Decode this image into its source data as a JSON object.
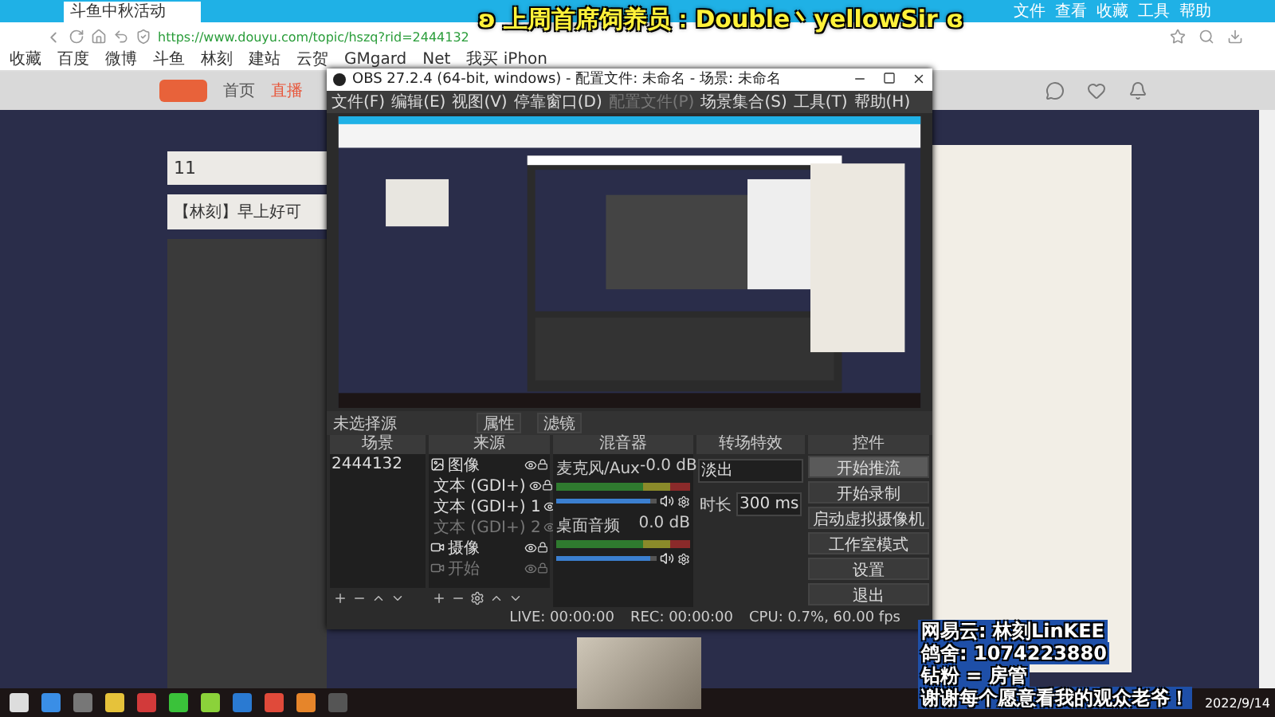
{
  "browser": {
    "tab": {
      "title": "斗鱼中秋活动"
    },
    "url": "https://www.douyu.com/topic/hszq?rid=2444132",
    "menu": [
      "文件",
      "查看",
      "收藏",
      "工具",
      "帮助"
    ],
    "bookmarks": [
      "收藏",
      "百度",
      "微博",
      "斗鱼",
      "林刻",
      "建站",
      "云贺",
      "GMgard",
      "Net",
      "我买 iPhon"
    ]
  },
  "banner": {
    "text": "ʚ 上周首席饲养员：Double丶yellowSir ɞ"
  },
  "site": {
    "nav": [
      {
        "label": "首页",
        "selected": false
      },
      {
        "label": "直播",
        "selected": true
      }
    ],
    "rank": "11",
    "room_title": "【林刻】早上好可"
  },
  "obs": {
    "title": "OBS 27.2.4 (64-bit, windows) - 配置文件: 未命名 - 场景: 未命名",
    "menu": [
      {
        "label": "文件(F)",
        "disabled": false
      },
      {
        "label": "编辑(E)",
        "disabled": false
      },
      {
        "label": "视图(V)",
        "disabled": false
      },
      {
        "label": "停靠窗口(D)",
        "disabled": false
      },
      {
        "label": "配置文件(P)",
        "disabled": true
      },
      {
        "label": "场景集合(S)",
        "disabled": false
      },
      {
        "label": "工具(T)",
        "disabled": false
      },
      {
        "label": "帮助(H)",
        "disabled": false
      }
    ],
    "toolbar": {
      "status": "未选择源",
      "buttons": [
        "属性",
        "滤镜"
      ]
    },
    "scenes": {
      "title": "场景",
      "items": [
        "2444132"
      ]
    },
    "sources": {
      "title": "来源",
      "items": [
        {
          "name": "图像",
          "kind": "image",
          "disabled": false
        },
        {
          "name": "文本 (GDI+)",
          "kind": "text",
          "disabled": false
        },
        {
          "name": "文本 (GDI+) 1",
          "kind": "text",
          "disabled": false
        },
        {
          "name": "文本 (GDI+) 2",
          "kind": "text",
          "disabled": true
        },
        {
          "name": "摄像",
          "kind": "camera",
          "disabled": false
        },
        {
          "name": "开始",
          "kind": "camera",
          "disabled": true
        }
      ]
    },
    "mixer": {
      "title": "混音器",
      "channels": [
        {
          "name": "麦克风/Aux",
          "reading": "-0.0 dB",
          "level": 0.93
        },
        {
          "name": "桌面音频",
          "reading": "0.0 dB",
          "level": 0.93
        }
      ]
    },
    "transitions": {
      "title": "转场特效",
      "value": "淡出",
      "duration_label": "时长",
      "duration": "300 ms"
    },
    "controls": {
      "title": "控件",
      "buttons": [
        {
          "label": "开始推流",
          "hovered": true
        },
        {
          "label": "开始录制",
          "hovered": false
        },
        {
          "label": "启动虚拟摄像机",
          "hovered": false
        },
        {
          "label": "工作室模式",
          "hovered": false
        },
        {
          "label": "设置",
          "hovered": false
        },
        {
          "label": "退出",
          "hovered": false
        }
      ]
    },
    "status": {
      "live": "LIVE: 00:00:00",
      "rec": "REC: 00:00:00",
      "cpu": "CPU: 0.7%, 60.00 fps"
    }
  },
  "overlay": {
    "lines": [
      "网易云: 林刻LinKEE",
      "鸽舍: 1074223880",
      "钻粉 = 房管",
      "谢谢每个愿意看我的观众老爷！"
    ]
  },
  "taskbar": {
    "date": "2022/9/14"
  }
}
